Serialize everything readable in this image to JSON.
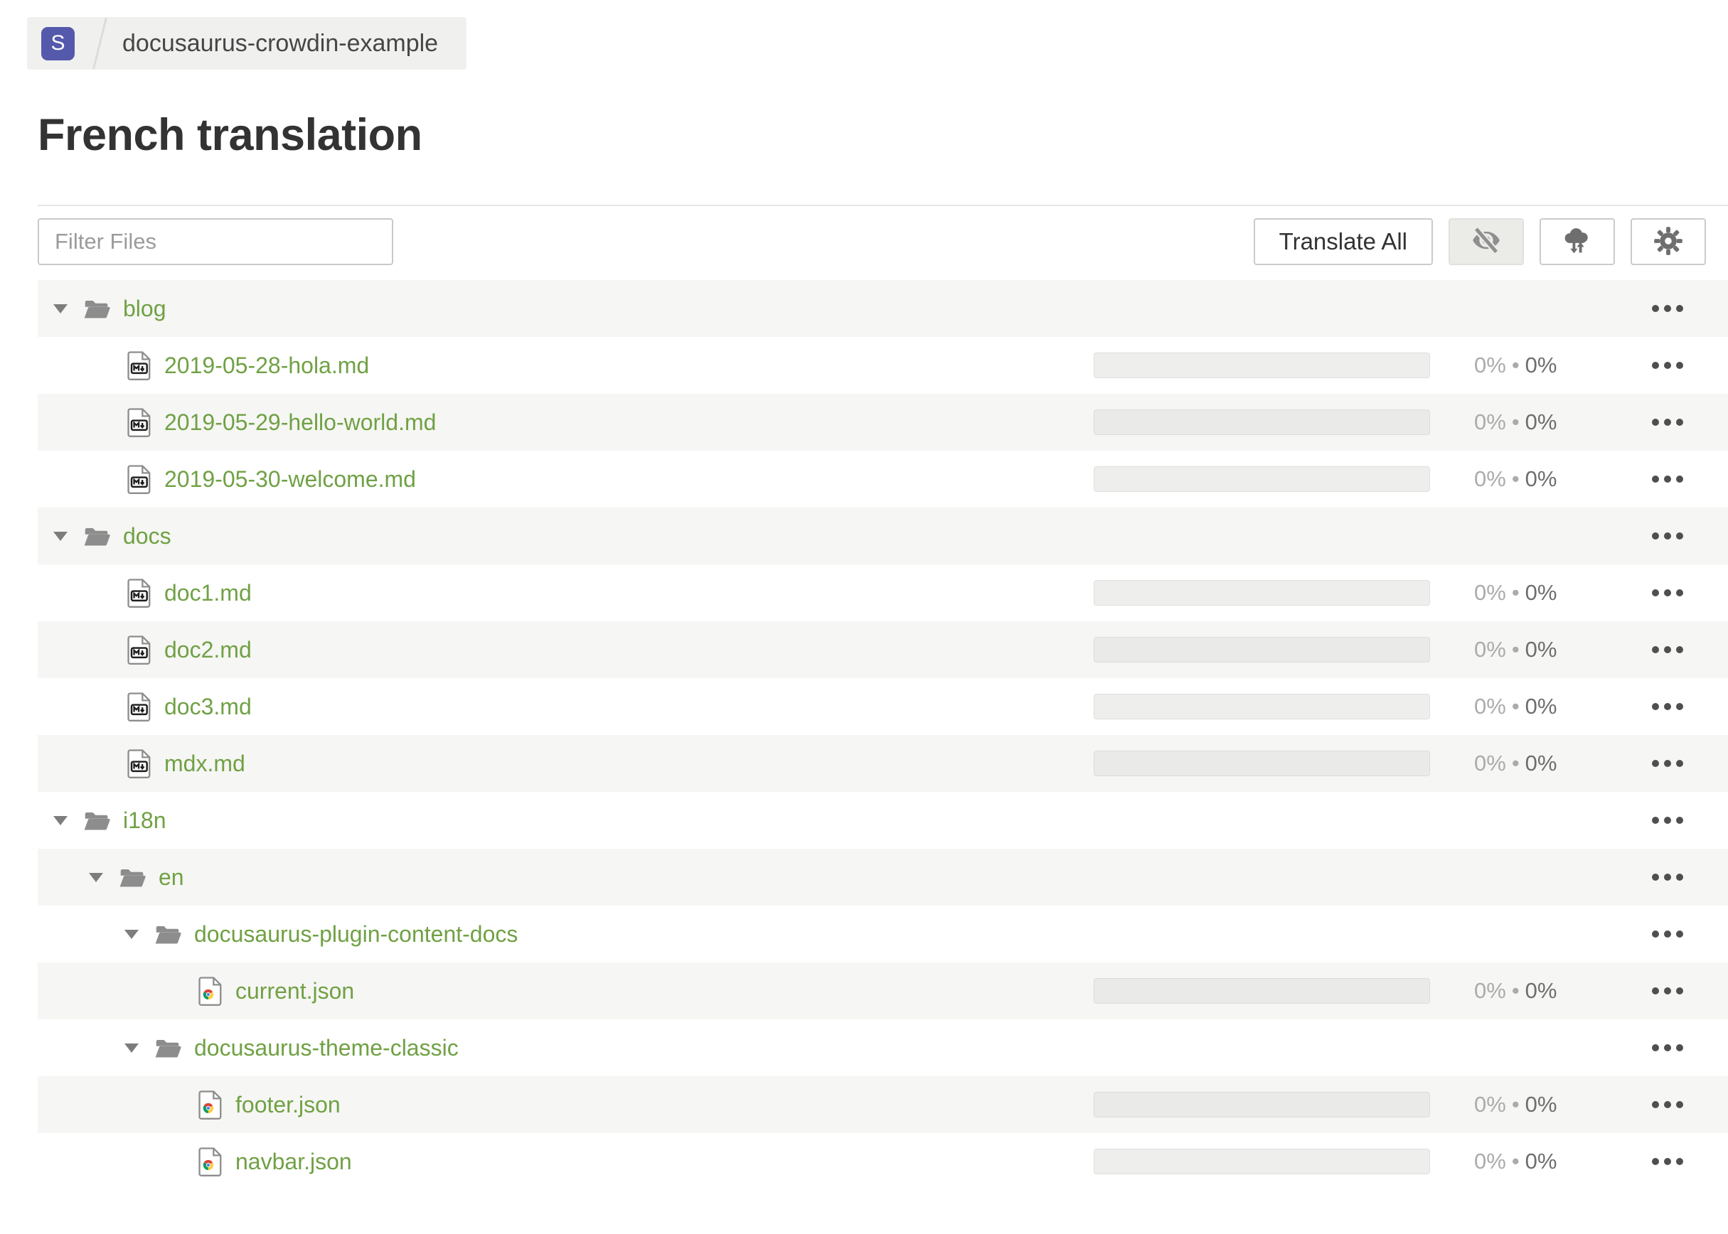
{
  "breadcrumb": {
    "badge": "S",
    "project": "docusaurus-crowdin-example"
  },
  "page": {
    "title": "French translation"
  },
  "toolbar": {
    "filter_placeholder": "Filter Files",
    "translate_all": "Translate All",
    "icon_buttons": [
      "eye-off-icon",
      "cloud-sync-icon",
      "gear-icon"
    ]
  },
  "colors": {
    "link_green": "#70a144",
    "badge_purple": "#5559ac",
    "row_shade": "#f6f6f4",
    "progress_track": "#eeeeec"
  },
  "tree": {
    "rows": [
      {
        "type": "folder",
        "icon": "folder",
        "level": 0,
        "name": "blog"
      },
      {
        "type": "file",
        "icon": "markdown",
        "level": 1,
        "name": "2019-05-28-hola.md",
        "translated": "0%",
        "bullet": "•",
        "approved": "0%"
      },
      {
        "type": "file",
        "icon": "markdown",
        "level": 1,
        "name": "2019-05-29-hello-world.md",
        "translated": "0%",
        "bullet": "•",
        "approved": "0%"
      },
      {
        "type": "file",
        "icon": "markdown",
        "level": 1,
        "name": "2019-05-30-welcome.md",
        "translated": "0%",
        "bullet": "•",
        "approved": "0%"
      },
      {
        "type": "folder",
        "icon": "folder",
        "level": 0,
        "name": "docs"
      },
      {
        "type": "file",
        "icon": "markdown",
        "level": 1,
        "name": "doc1.md",
        "translated": "0%",
        "bullet": "•",
        "approved": "0%"
      },
      {
        "type": "file",
        "icon": "markdown",
        "level": 1,
        "name": "doc2.md",
        "translated": "0%",
        "bullet": "•",
        "approved": "0%"
      },
      {
        "type": "file",
        "icon": "markdown",
        "level": 1,
        "name": "doc3.md",
        "translated": "0%",
        "bullet": "•",
        "approved": "0%"
      },
      {
        "type": "file",
        "icon": "markdown",
        "level": 1,
        "name": "mdx.md",
        "translated": "0%",
        "bullet": "•",
        "approved": "0%"
      },
      {
        "type": "folder",
        "icon": "folder",
        "level": 0,
        "name": "i18n"
      },
      {
        "type": "folder",
        "icon": "folder",
        "level": 1,
        "name": "en"
      },
      {
        "type": "folder",
        "icon": "folder",
        "level": 2,
        "name": "docusaurus-plugin-content-docs"
      },
      {
        "type": "file",
        "icon": "json",
        "level": 3,
        "name": "current.json",
        "translated": "0%",
        "bullet": "•",
        "approved": "0%"
      },
      {
        "type": "folder",
        "icon": "folder",
        "level": 2,
        "name": "docusaurus-theme-classic"
      },
      {
        "type": "file",
        "icon": "json",
        "level": 3,
        "name": "footer.json",
        "translated": "0%",
        "bullet": "•",
        "approved": "0%"
      },
      {
        "type": "file",
        "icon": "json",
        "level": 3,
        "name": "navbar.json",
        "translated": "0%",
        "bullet": "•",
        "approved": "0%"
      }
    ]
  }
}
